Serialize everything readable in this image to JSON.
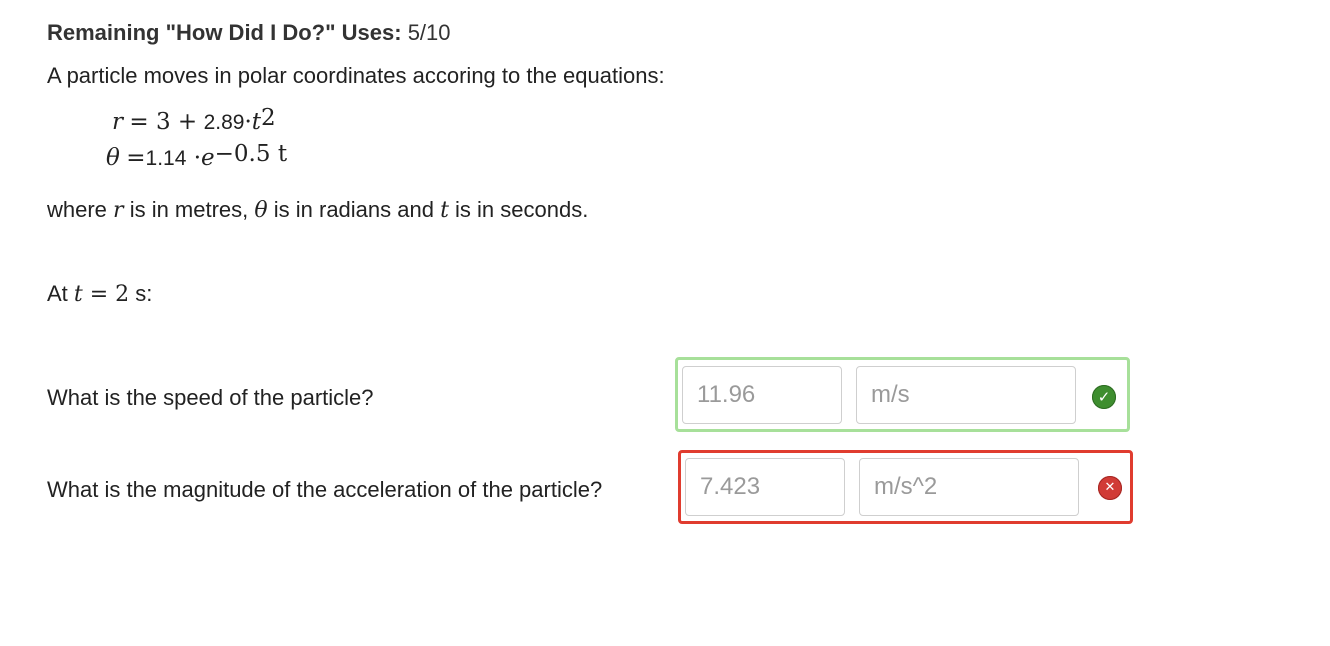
{
  "header": {
    "remaining_label": "Remaining \"How Did I Do?\" Uses:",
    "remaining_value": "5/10"
  },
  "problem": {
    "intro": "A particle moves in polar coordinates accoring to the equations:",
    "eq_r": {
      "var": "r",
      "op": "= 3 +",
      "coef": "2.89",
      "dot": "·",
      "t": "t",
      "exp": "2"
    },
    "eq_theta": {
      "var": "θ",
      "eq": "=",
      "coef": "1.14",
      "dot": " ·",
      "e": "e",
      "exp": "−0.5 t"
    },
    "where": {
      "p1": "where ",
      "r": "r",
      "p2": " is in metres, ",
      "theta": "θ",
      "p3": " is in radians and ",
      "t": "t",
      "p4": " is in seconds."
    },
    "at": {
      "p1": "At ",
      "t": "t",
      "eq": " = 2",
      "unit": " s:"
    }
  },
  "questions": [
    {
      "label": "What is the speed of the particle?",
      "value": "11.96",
      "unit": "m/s",
      "status": "correct"
    },
    {
      "label": "What is the magnitude of the acceleration of the particle?",
      "value": "7.423",
      "unit": "m/s^2",
      "status": "incorrect"
    }
  ],
  "colors": {
    "correct_border": "#a7e09a",
    "incorrect_border": "#e03c2f",
    "correct_icon": "#3e8e2f",
    "incorrect_icon": "#d13b36"
  },
  "icons": {
    "correct": "check-icon",
    "incorrect": "x-icon"
  },
  "icon_glyphs": {
    "check": "✓",
    "x": "✕"
  }
}
